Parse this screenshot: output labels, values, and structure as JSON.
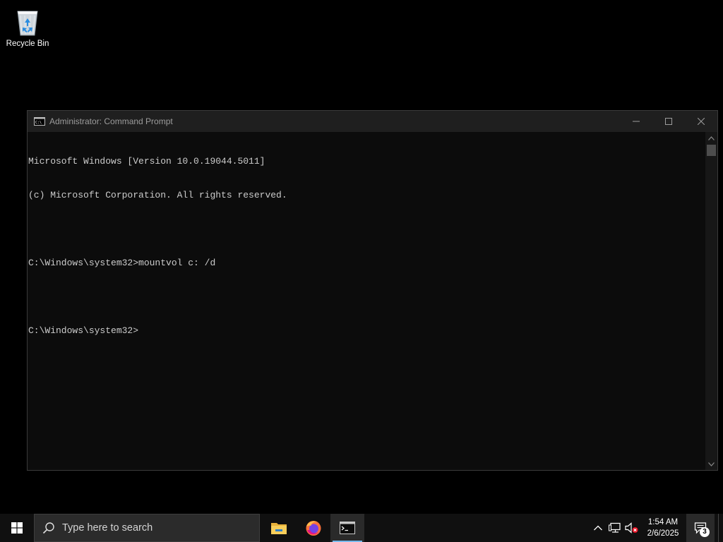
{
  "desktop": {
    "icons": [
      {
        "label": "Recycle Bin",
        "icon": "recycle-bin-icon"
      }
    ]
  },
  "window": {
    "title": "Administrator: Command Prompt",
    "icon": "console-icon",
    "controls": [
      "minimize-icon",
      "maximize-icon",
      "close-icon"
    ],
    "lines": [
      "Microsoft Windows [Version 10.0.19044.5011]",
      "(c) Microsoft Corporation. All rights reserved.",
      "",
      "C:\\Windows\\system32>mountvol c: /d",
      "",
      "C:\\Windows\\system32>"
    ],
    "colors": {
      "background": "#0c0c0c",
      "text": "#cccccc",
      "titlebar": "#1f1f1f"
    }
  },
  "taskbar": {
    "start_icon": "windows-logo-icon",
    "search": {
      "placeholder": "Type here to search",
      "icon": "search-icon"
    },
    "apps": [
      {
        "name": "File Explorer",
        "icon": "folder-icon",
        "active": false
      },
      {
        "name": "Firefox",
        "icon": "firefox-icon",
        "active": false
      },
      {
        "name": "Command Prompt",
        "icon": "console-icon",
        "active": true
      }
    ],
    "tray_icons": [
      "chevron-up-icon",
      "network-icon",
      "volume-muted-icon"
    ],
    "clock": {
      "time": "1:54 AM",
      "date": "2/6/2025"
    },
    "notifications": {
      "count": "3",
      "icon": "notification-icon"
    },
    "accent": "#76b9ed"
  }
}
